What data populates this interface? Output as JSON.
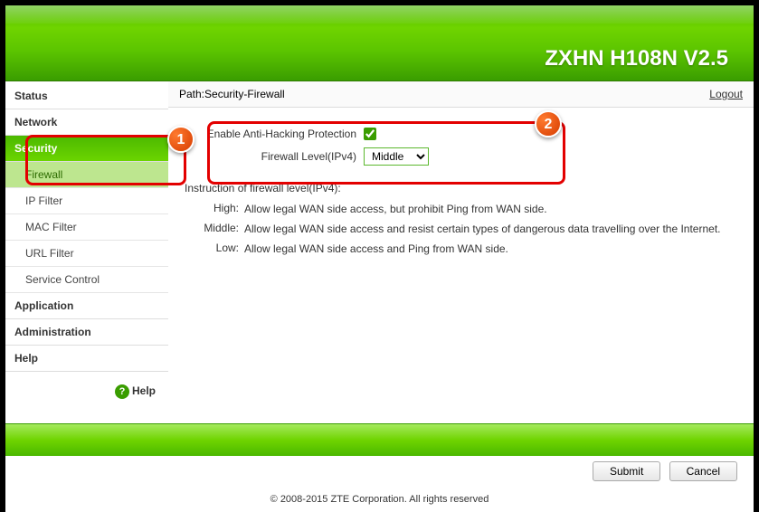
{
  "header": {
    "title": "ZXHN H108N V2.5"
  },
  "sidebar": {
    "status": "Status",
    "network": "Network",
    "security": "Security",
    "firewall": "Firewall",
    "ip_filter": "IP Filter",
    "mac_filter": "MAC Filter",
    "url_filter": "URL Filter",
    "service_control": "Service Control",
    "application": "Application",
    "administration": "Administration",
    "help": "Help",
    "help_link": "Help"
  },
  "path": {
    "label": "Path:Security-Firewall",
    "logout": "Logout"
  },
  "form": {
    "enable_label": "Enable Anti-Hacking Protection",
    "enable_checked": true,
    "level_label": "Firewall Level(IPv4)",
    "level_value": "Middle"
  },
  "instructions": {
    "title": "Instruction of firewall level(IPv4):",
    "high_label": "High:",
    "high_text": "Allow legal WAN side access, but prohibit Ping from WAN side.",
    "middle_label": "Middle:",
    "middle_text": "Allow legal WAN side access and resist certain types of dangerous data travelling over the Internet.",
    "low_label": "Low:",
    "low_text": "Allow legal WAN side access and Ping from WAN side."
  },
  "buttons": {
    "submit": "Submit",
    "cancel": "Cancel"
  },
  "copyright": "© 2008-2015 ZTE Corporation. All rights reserved",
  "annotations": {
    "badge1": "1",
    "badge2": "2"
  }
}
